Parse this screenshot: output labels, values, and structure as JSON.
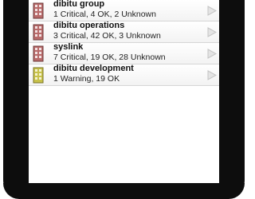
{
  "groups": [
    {
      "name": "dibitu group",
      "status": "1 Critical, 4 OK, 2 Unknown",
      "state": "critical",
      "icon": "building-red-icon"
    },
    {
      "name": "dibitu operations",
      "status": "3 Critical, 42 OK, 3 Unknown",
      "state": "critical",
      "icon": "building-red-icon"
    },
    {
      "name": "syslink",
      "status": "7 Critical, 19 OK, 28 Unknown",
      "state": "critical",
      "icon": "building-red-icon"
    },
    {
      "name": "dibitu development",
      "status": "1 Warning, 19 OK",
      "state": "warning",
      "icon": "building-yellow-icon"
    }
  ],
  "colors": {
    "critical": "#b86a6a",
    "warning": "#c8c24a",
    "phone_bezel": "#0d0d0d"
  }
}
